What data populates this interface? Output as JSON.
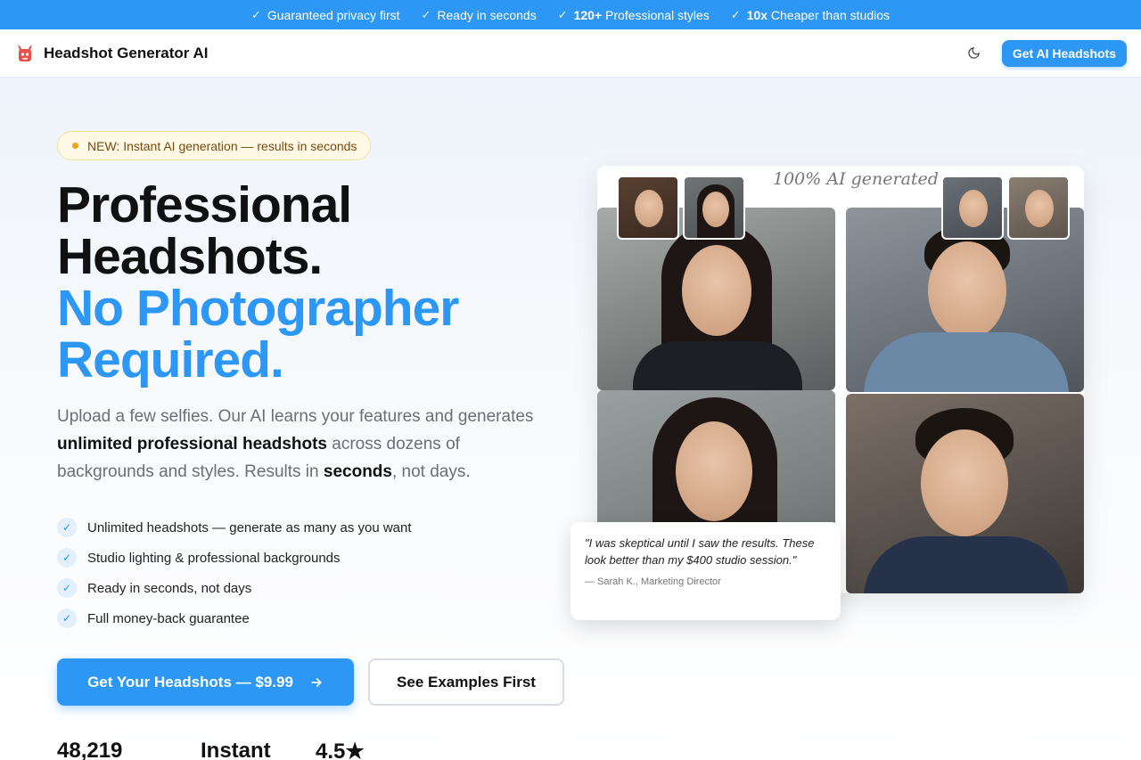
{
  "topbar": {
    "items": [
      {
        "bold": "",
        "text": "Guaranteed privacy first"
      },
      {
        "bold": "",
        "text": "Ready in seconds"
      },
      {
        "bold": "120+",
        "text": " Professional styles"
      },
      {
        "bold": "10x",
        "text": " Cheaper than studios"
      }
    ]
  },
  "nav": {
    "brand": "Headshot Generator AI",
    "cta": "Get AI Headshots"
  },
  "hero": {
    "badge": "NEW: Instant AI generation — results in seconds",
    "title_line1": "Professional",
    "title_line2": "Headshots.",
    "title_line3": "No Photographer",
    "title_line4": "Required.",
    "lede_part1": "Upload a few selfies. Our AI learns your features and generates ",
    "lede_bold1": "unlimited professional headshots",
    "lede_part2": " across dozens of backgrounds and styles. Results in ",
    "lede_bold2": "seconds",
    "lede_part3": ", not days.",
    "checks": [
      "Unlimited headshots — generate as many as you want",
      "Studio lighting & professional backgrounds",
      "Ready in seconds, not days",
      "Full money-back guarantee"
    ],
    "primary_cta": "Get Your Headshots — $9.99",
    "secondary_cta": "See Examples First",
    "stats": [
      "48,219",
      "Instant",
      "4.5★"
    ]
  },
  "collage": {
    "note": "100% AI generated"
  },
  "testimonial": {
    "quote": "\"I was skeptical until I saw the results. These look better than my $400 studio session.\"",
    "author": "— Sarah K., Marketing Director"
  },
  "colors": {
    "accent": "#2d97f5",
    "badge_bg": "#fff9e6",
    "badge_dot": "#f0a21d"
  }
}
